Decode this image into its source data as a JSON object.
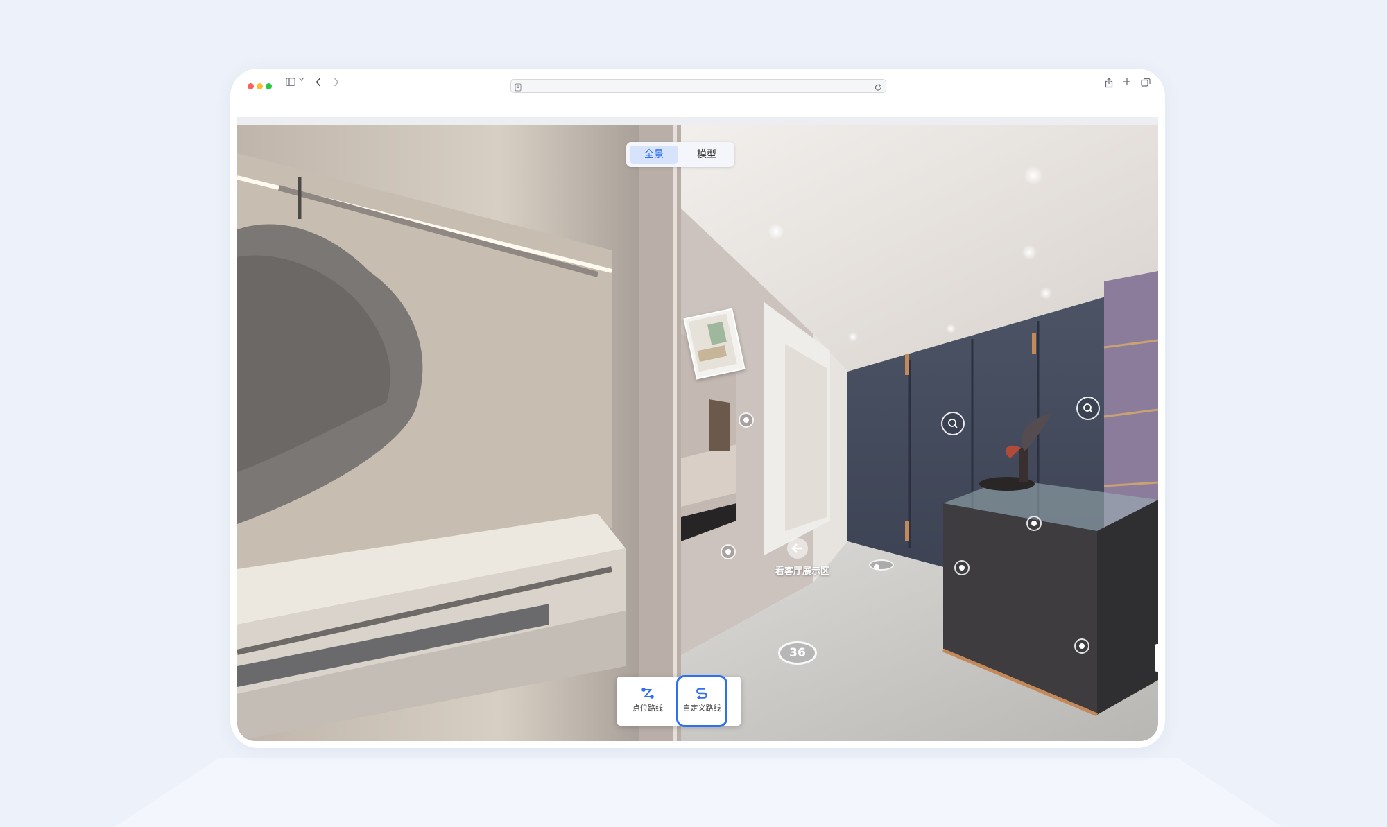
{
  "view_toggle": {
    "active_label": "全景",
    "inactive_label": "模型"
  },
  "hotspot": {
    "label": "看客厅展示区",
    "number_badge": "36"
  },
  "route_bar": {
    "point_route_label": "点位路线",
    "custom_route_label": "自定义路线"
  },
  "icons": {
    "browser": [
      "sidebar-icon",
      "chevron-down-icon",
      "back-icon",
      "forward-icon",
      "page-icon",
      "reload-icon",
      "share-icon",
      "new-tab-icon",
      "tabs-icon"
    ],
    "scene": [
      "magnifier-icon",
      "arrow-left-icon",
      "hotspot-dot-icon",
      "point-route-icon",
      "custom-route-icon"
    ]
  },
  "colors": {
    "accent": "#2f6ff0",
    "page_background": "#edf1f9",
    "toggle_active_bg": "#d6e3fb"
  }
}
